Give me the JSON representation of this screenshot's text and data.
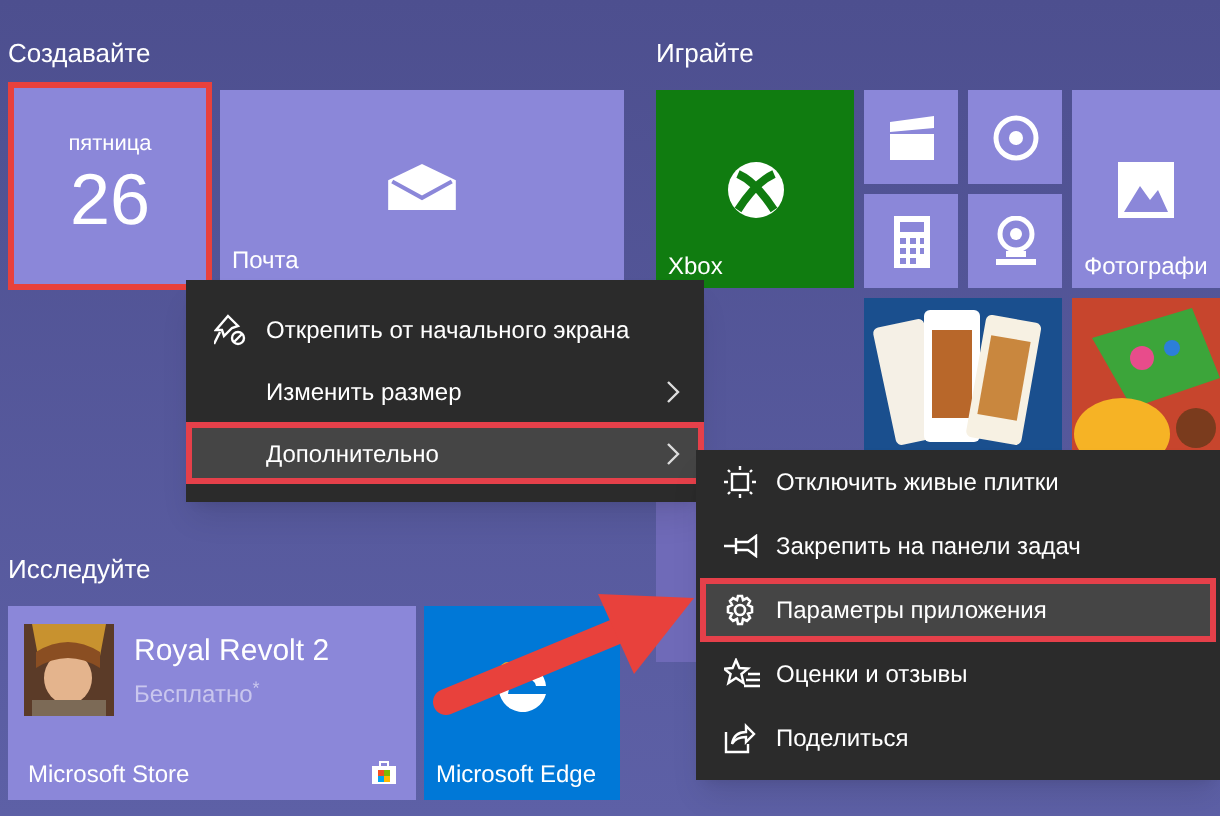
{
  "create": {
    "title": "Создавайте",
    "tiles": [
      {
        "kind": "calendar",
        "day": "пятница",
        "date": "26",
        "annotated": true
      },
      {
        "kind": "mail",
        "label": "Почта"
      }
    ]
  },
  "play": {
    "title": "Играйте",
    "tiles": [
      {
        "kind": "xbox",
        "label": "Xbox"
      },
      {
        "kind": "film"
      },
      {
        "kind": "disc"
      },
      {
        "kind": "photos",
        "label": "Фотографи"
      },
      {
        "kind": "calculator"
      },
      {
        "kind": "webcam"
      },
      {
        "kind": "cards"
      },
      {
        "kind": "candy"
      },
      {
        "kind": "sweets"
      }
    ]
  },
  "explore": {
    "title": "Исследуйте",
    "tiles": [
      {
        "kind": "store",
        "label": "Microsoft Store",
        "app": "Royal Revolt 2",
        "price": "Бесплатно$^{*}$"
      },
      {
        "kind": "edge",
        "label": "Microsoft Edge"
      }
    ]
  },
  "context_menu": {
    "items": [
      {
        "label": "Открепить от начального экрана",
        "submenu": false,
        "selected": false
      },
      {
        "label": "Изменить размер",
        "submenu": true,
        "selected": false
      },
      {
        "label": "Дополнительно",
        "submenu": true,
        "selected": true
      }
    ]
  },
  "more_menu": {
    "items": [
      {
        "label": "Отключить живые плитки",
        "selected": false
      },
      {
        "label": "Закрепить на панели задач",
        "selected": false
      },
      {
        "label": "Параметры приложения",
        "selected": true
      },
      {
        "label": "Оценки и отзывы",
        "selected": false
      },
      {
        "label": "Поделиться",
        "selected": false
      }
    ]
  }
}
